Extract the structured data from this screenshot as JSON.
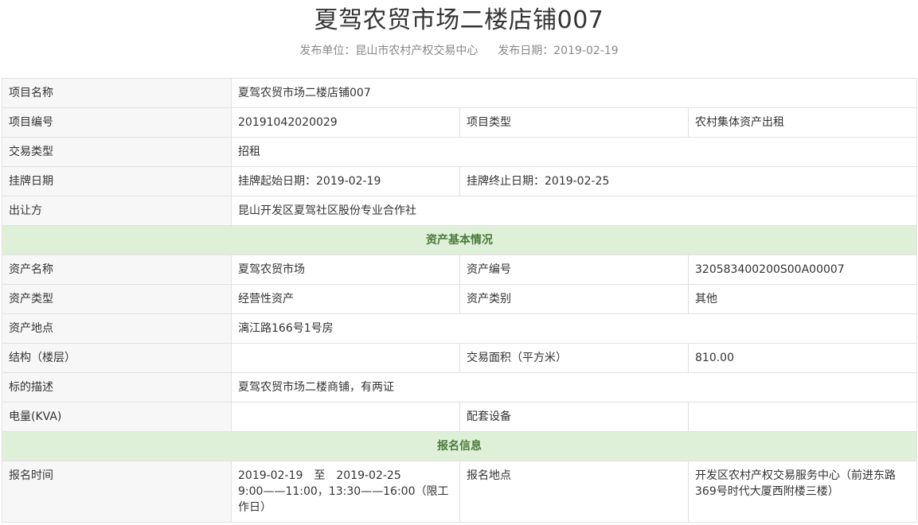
{
  "page": {
    "title": "夏驾农贸市场二楼店铺007",
    "publisher_label": "发布单位：",
    "publisher": "昆山市农村产权交易中心",
    "date_label": "发布日期：",
    "date": "2019-02-19"
  },
  "rows": {
    "project_name": {
      "label": "项目名称",
      "value": "夏驾农贸市场二楼店铺007"
    },
    "project_no": {
      "label": "项目编号",
      "value": "20191042020029"
    },
    "project_type": {
      "label": "项目类型",
      "value": "农村集体资产出租"
    },
    "trade_type": {
      "label": "交易类型",
      "value": "招租"
    },
    "listing_date": {
      "label": "挂牌日期",
      "start": "挂牌起始日期：2019-02-19",
      "end": "挂牌终止日期：2019-02-25"
    },
    "transferor": {
      "label": "出让方",
      "value": "昆山开发区夏驾社区股份专业合作社"
    }
  },
  "asset_section": {
    "heading": "资产基本情况",
    "asset_name": {
      "label": "资产名称",
      "value": "夏驾农贸市场"
    },
    "asset_no": {
      "label": "资产编号",
      "value": "320583400200S00A00007"
    },
    "asset_type": {
      "label": "资产类型",
      "value": "经营性资产"
    },
    "asset_category": {
      "label": "资产类别",
      "value": "其他"
    },
    "asset_location": {
      "label": "资产地点",
      "value": "漓江路166号1号房"
    },
    "structure": {
      "label": "结构（楼层）",
      "value": ""
    },
    "area": {
      "label": "交易面积（平方米）",
      "value": "810.00"
    },
    "description": {
      "label": "标的描述",
      "value": "夏驾农贸市场二楼商铺，有两证"
    },
    "power": {
      "label": "电量(KVA)",
      "value": ""
    },
    "equipment": {
      "label": "配套设备",
      "value": ""
    }
  },
  "signup_section": {
    "heading": "报名信息",
    "time": {
      "label": "报名时间",
      "dates": "2019-02-19　至　2019-02-25",
      "hours": "9:00——11:00，13:30——16:00（限工作日）"
    },
    "place": {
      "label": "报名地点",
      "value": "开发区农村产权交易服务中心（前进东路369号时代大厦西附楼三楼）"
    }
  }
}
